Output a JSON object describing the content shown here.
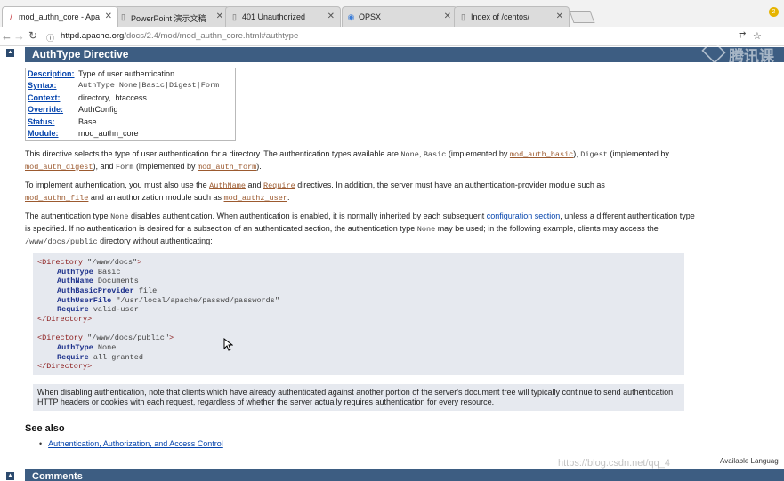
{
  "browser": {
    "tabs": [
      {
        "label": "mod_authn_core - Apa",
        "icon": "apache-feather-icon",
        "active": true
      },
      {
        "label": "PowerPoint 演示文稿",
        "icon": "page-icon",
        "active": false
      },
      {
        "label": "401 Unauthorized",
        "icon": "page-icon",
        "active": false
      },
      {
        "label": "OPSX",
        "icon": "globe-icon",
        "active": false
      },
      {
        "label": "Index of /centos/",
        "icon": "page-icon",
        "active": false
      }
    ],
    "url_host": "httpd.apache.org",
    "url_path": "/docs/2.4/mod/mod_authn_core.html#authtype",
    "extension_badge": "2"
  },
  "page": {
    "section_title": "AuthType Directive",
    "top_link_glyph": "▲",
    "directive_info": [
      {
        "key": "Description:",
        "value": "Type of user authentication",
        "mono": false
      },
      {
        "key": "Syntax:",
        "value": "AuthType None|Basic|Digest|Form",
        "mono": true
      },
      {
        "key": "Context:",
        "value": "directory, .htaccess",
        "mono": false
      },
      {
        "key": "Override:",
        "value": "AuthConfig",
        "mono": false
      },
      {
        "key": "Status:",
        "value": "Base",
        "mono": false
      },
      {
        "key": "Module:",
        "value": "mod_authn_core",
        "mono": false
      }
    ],
    "para1": {
      "t1": "This directive selects the type of user authentication for a directory. The authentication types available are ",
      "c_none": "None",
      "t2": ", ",
      "c_basic": "Basic",
      "t3": " (implemented by ",
      "l_basic": "mod_auth_basic",
      "t4": "), ",
      "c_digest": "Digest",
      "t5": " (implemented by ",
      "l_digest": "mod_auth_digest",
      "t6": "), and ",
      "c_form": "Form",
      "t7": " (implemented by ",
      "l_form": "mod_auth_form",
      "t8": ")."
    },
    "para2": {
      "t1": "To implement authentication, you must also use the ",
      "l_authname": "AuthName",
      "t2": " and ",
      "l_require": "Require",
      "t3": " directives. In addition, the server must have an authentication-provider module such as",
      "l_file": "mod_authn_file",
      "t4": " and an authorization module such as ",
      "l_user": "mod_authz_user",
      "t5": "."
    },
    "para3": {
      "t1": "The authentication type ",
      "c_none": "None",
      "t2": " disables authentication. When authentication is enabled, it is normally inherited by each subsequent ",
      "l_config": "configuration section",
      "t3": ", unless a different authentication type is specified. If no authentication is desired for a subsection of an authenticated section, the authentication type ",
      "c_none2": "None",
      "t4": " may be used; in the following example, clients may access the ",
      "c_path": "/www/docs/public",
      "t5": " directory without authenticating:"
    },
    "code": {
      "l1_open": "<Directory",
      "l1_arg": " \"/www/docs\"",
      "l1_close": ">",
      "l2_dir": "AuthType",
      "l2_arg": " Basic",
      "l3_dir": "AuthName",
      "l3_arg": " Documents",
      "l4_dir": "AuthBasicProvider",
      "l4_arg": " file",
      "l5_dir": "AuthUserFile",
      "l5_arg": " \"/usr/local/apache/passwd/passwords\"",
      "l6_dir": "Require",
      "l6_arg": " valid-user",
      "l7": "</Directory>",
      "l8_open": "<Directory",
      "l8_arg": " \"/www/docs/public\"",
      "l8_close": ">",
      "l9_dir": "AuthType",
      "l9_arg": " None",
      "l10_dir": "Require",
      "l10_arg": " all granted",
      "l11": "</Directory>"
    },
    "note": "When disabling authentication, note that clients which have already authenticated against another portion of the server's document tree will typically continue to send authentication HTTP headers or cookies with each request, regardless of whether the server actually requires authentication for every resource.",
    "see_also_title": "See also",
    "see_also_link": "Authentication, Authorization, and Access Control",
    "comments_title": "Comments",
    "available_languages": "Available Languag",
    "csdn_watermark": "https://blog.csdn.net/qq_4",
    "logo_watermark": "腾讯课"
  },
  "colors": {
    "section_bar": "#3d5d82",
    "link": "#0645ad",
    "module_link": "#9c5a2f",
    "code_bg": "#e6e9ef"
  }
}
